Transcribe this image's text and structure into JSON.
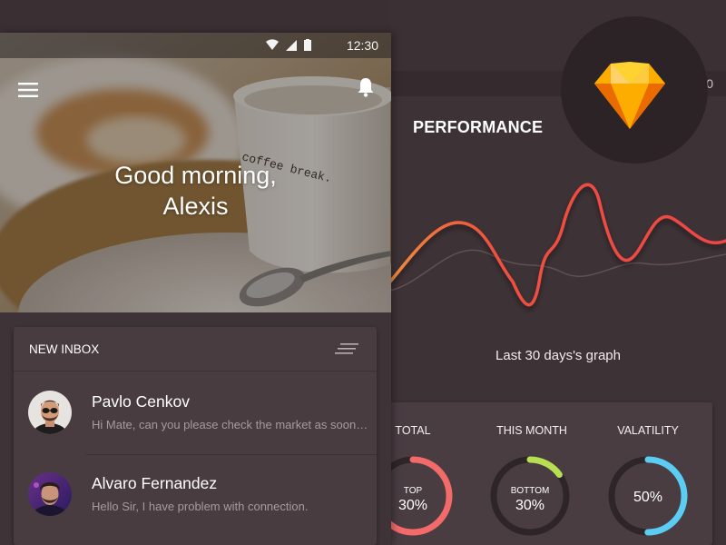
{
  "performance_screen": {
    "time": "12:30",
    "title": "PERFORMANCE",
    "graph_caption": "Last 30 days's graph",
    "stats": [
      {
        "label": "TOTAL",
        "sublabel": "TOP",
        "value": "30%",
        "fraction": 0.8,
        "color": "#f26a6a"
      },
      {
        "label": "THIS MONTH",
        "sublabel": "BOTTOM",
        "value": "30%",
        "fraction": 0.15,
        "color": "#b6e052"
      },
      {
        "label": "VALATILITY",
        "sublabel": "",
        "value": "50%",
        "fraction": 0.5,
        "color": "#5ccdf2"
      }
    ]
  },
  "phone": {
    "status": {
      "time": "12:30"
    },
    "greeting_line1": "Good morning,",
    "greeting_line2": "Alexis",
    "inbox": {
      "title": "NEW INBOX",
      "messages": [
        {
          "name": "Pavlo Cenkov",
          "preview": "Hi Mate, can you please check the market as soon as possible"
        },
        {
          "name": "Alvaro Fernandez",
          "preview": "Hello Sir, I have problem with connection."
        }
      ]
    }
  },
  "colors": {
    "accent_line": "#f0513f",
    "background": "#3a2f33",
    "card": "#483c41"
  },
  "icons": [
    "menu-icon",
    "bell-icon",
    "wifi-icon",
    "signal-icon",
    "battery-icon",
    "sort-icon",
    "sketch-logo"
  ]
}
